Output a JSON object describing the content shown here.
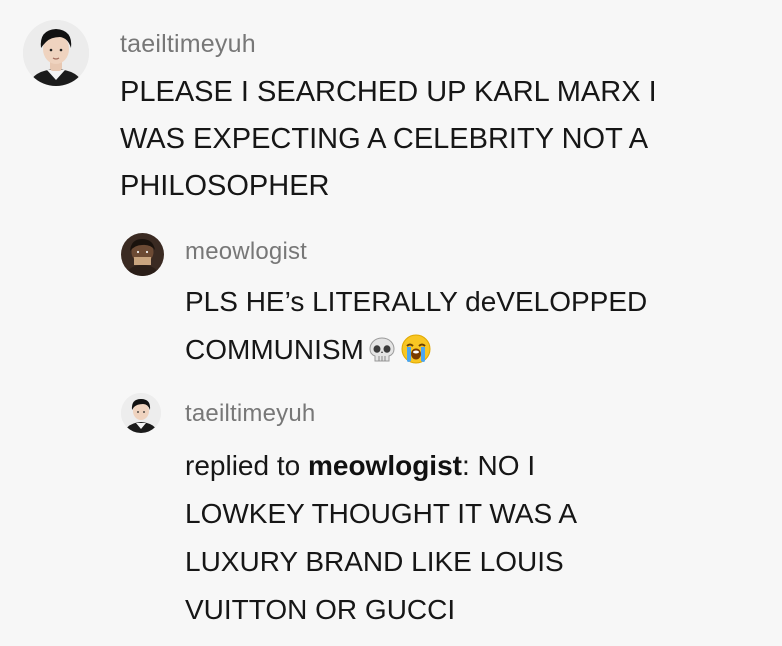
{
  "comments": [
    {
      "username": "taeiltimeyuh",
      "lines": [
        "PLEASE I SEARCHED UP KARL MARX I",
        "WAS EXPECTING A CELEBRITY NOT A",
        "PHILOSOPHER"
      ]
    },
    {
      "username": "meowlogist",
      "lines": [
        "PLS HE’s LITERALLY deVELOPPED",
        "COMMUNISM"
      ],
      "emojis": [
        "skull-emoji",
        "loudly-crying-face-emoji"
      ]
    },
    {
      "username": "taeiltimeyuh",
      "reply_prefix": "replied to ",
      "reply_to": "meowlogist",
      "reply_colon": ":",
      "lines": [
        " NO I",
        "LOWKEY THOUGHT IT WAS A",
        "LUXURY BRAND LIKE LOUIS",
        "VUITTON OR GUCCI"
      ]
    }
  ]
}
